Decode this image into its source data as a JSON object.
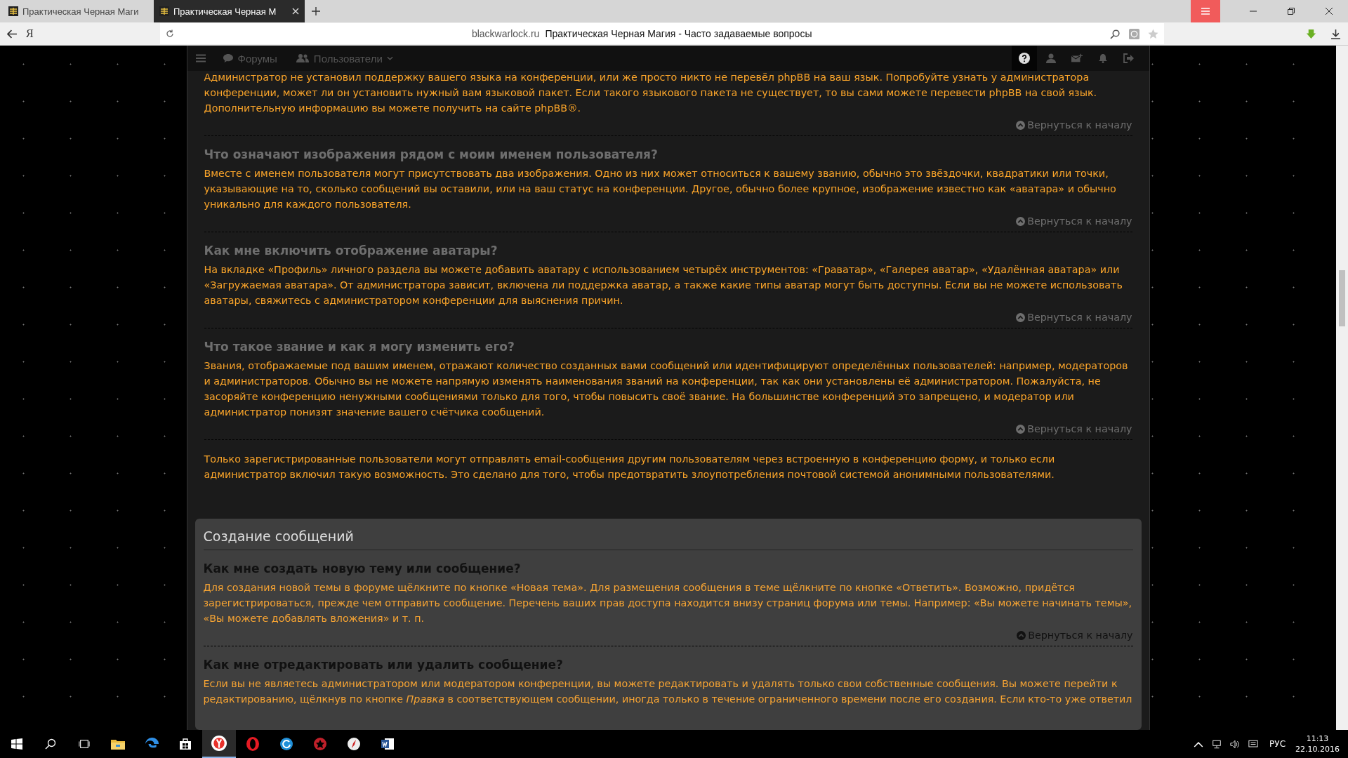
{
  "browser": {
    "tabs": [
      {
        "title": "Практическая Черная Маги",
        "selected": false
      },
      {
        "title": "Практическая Черная М",
        "selected": true
      }
    ],
    "logo": "Я",
    "address": {
      "domain": "blackwarlock.ru",
      "page_title": "Практическая Черная Магия - Часто задаваемые вопросы"
    }
  },
  "navbar": {
    "links": [
      {
        "label": "Форумы",
        "kind": "forums",
        "dropdown": false
      },
      {
        "label": "Пользователи",
        "kind": "users",
        "dropdown": true
      }
    ]
  },
  "sections": [
    {
      "kind": "dark",
      "items": [
        {
          "answer": "Администратор не установил поддержку вашего языка на конференции, или же просто никто не перевёл phpBB на ваш язык. Попробуйте узнать у администратора конференции, может ли он установить нужный вам языковой пакет. Если такого языкового пакета не существует, то вы сами можете перевести phpBB на свой язык. Дополнительную информацию вы можете получить на сайте phpBB®.",
          "back_link": "Вернуться к началу"
        },
        {
          "question": "Что означают изображения рядом с моим именем пользователя?",
          "answer": "Вместе с именем пользователя могут присутствовать два изображения. Одно из них может относиться к вашему званию, обычно это звёздочки, квадратики или точки, указывающие на то, сколько сообщений вы оставили, или на ваш статус на конференции. Другое, обычно более крупное, изображение известно как «аватара» и обычно уникально для каждого пользователя.",
          "back_link": "Вернуться к началу"
        },
        {
          "question": "Как мне включить отображение аватары?",
          "answer": "На вкладке «Профиль» личного раздела вы можете добавить аватару с использованием четырёх инструментов: «Граватар», «Галерея аватар», «Удалённая аватара» или «Загружаемая аватара». От администратора зависит, включена ли поддержка аватар, а также какие типы аватар могут быть доступны. Если вы не можете использовать аватары, свяжитесь с администратором конференции для выяснения причин.",
          "back_link": "Вернуться к началу"
        },
        {
          "question": "Что такое звание и как я могу изменить его?",
          "answer": "Звания, отображаемые под вашим именем, отражают количество созданных вами сообщений или идентифицируют определённых пользователей: например, модераторов и администраторов. Обычно вы не можете напрямую изменять наименования званий на конференции, так как они установлены её администратором. Пожалуйста, не засоряйте конференцию ненужными сообщениями только для того, чтобы повысить своё звание. На большинстве конференций это запрещено, и модератор или администратор понизят значение вашего счётчика сообщений.",
          "back_link": "Вернуться к началу"
        },
        {
          "answer": "Только зарегистрированные пользователи могут отправлять email-сообщения другим пользователям через встроенную в конференцию форму, и только если администратор включил такую возможность. Это сделано для того, чтобы предотвратить злоупотребления почтовой системой анонимными пользователями."
        }
      ]
    },
    {
      "kind": "grey",
      "title": "Создание сообщений",
      "items": [
        {
          "question": "Как мне создать новую тему или сообщение?",
          "answer": "Для создания новой темы в форуме щёлкните по кнопке «Новая тема». Для размещения сообщения в теме щёлкните по кнопке «Ответить». Возможно, придётся зарегистрироваться, прежде чем отправить сообщение. Перечень ваших прав доступа находится внизу страниц форума или темы. Например: «Вы можете начинать темы», «Вы можете добавлять вложения» и т. п.",
          "back_link": "Вернуться к началу"
        },
        {
          "question": "Как мне отредактировать или удалить сообщение?",
          "answer": "Если вы не являетесь администратором или модератором конференции, вы можете редактировать и удалять только свои собственные сообщения. Вы можете перейти к редактированию, щёлкнув по кнопке *Правка* в соответствующем сообщении, иногда только в течение ограниченного времени после его создания. Если кто-то уже ответил"
        }
      ]
    }
  ],
  "taskbar": {
    "apps": [
      {
        "kind": "explorer",
        "selected": false
      },
      {
        "kind": "edge",
        "selected": false
      },
      {
        "kind": "store",
        "selected": false
      },
      {
        "kind": "yandex",
        "selected": true
      },
      {
        "kind": "opera",
        "selected": false
      },
      {
        "kind": "sync",
        "selected": false
      },
      {
        "kind": "game",
        "selected": false
      },
      {
        "kind": "compass",
        "selected": false
      },
      {
        "kind": "word",
        "selected": false
      }
    ],
    "language": "РУС",
    "time": "11:13",
    "date": "22.10.2016"
  }
}
